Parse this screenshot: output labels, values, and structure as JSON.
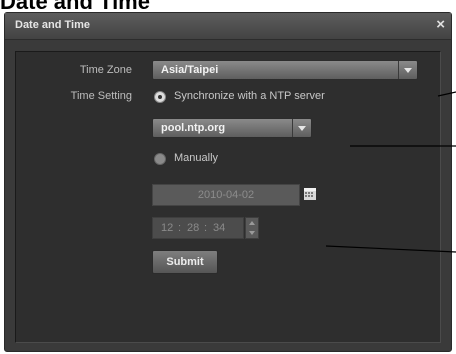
{
  "page": {
    "heading": "Date and Time"
  },
  "dialog": {
    "title": "Date and Time",
    "close_glyph": "×",
    "icons": [
      "close-icon",
      "chevron-down-icon",
      "calendar-icon",
      "spinner-up-icon",
      "spinner-down-icon"
    ]
  },
  "form": {
    "time_zone_label": "Time Zone",
    "time_zone_value": "Asia/Taipei",
    "time_setting_label": "Time Setting",
    "ntp_option_label": "Synchronize with a NTP server",
    "ntp_option_selected": true,
    "ntp_server_value": "pool.ntp.org",
    "manual_option_label": "Manually",
    "manual_option_selected": false,
    "date_value": "2010-04-02",
    "time_hours": "12",
    "time_minutes": "28",
    "time_seconds": "34",
    "submit_label": "Submit"
  },
  "colors": {
    "dialog_bg": "#3a3a3a",
    "panel_bg": "#2e2e2e",
    "control_gradient_top": "#8a8a8a",
    "control_gradient_bottom": "#5e5e5e",
    "text": "#bdbdbd"
  }
}
